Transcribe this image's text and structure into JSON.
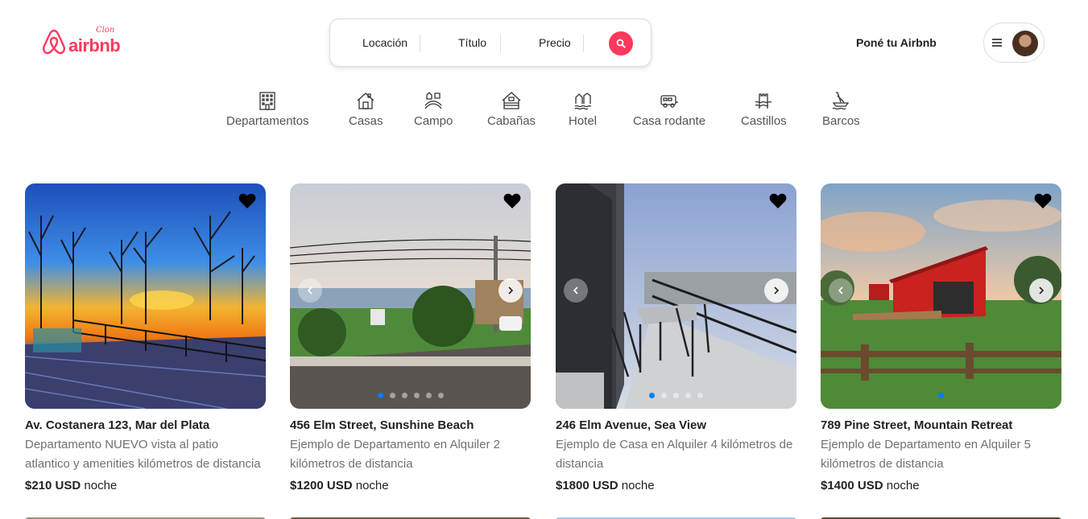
{
  "header": {
    "logo_text": "airbnb",
    "logo_badge": "Clon",
    "search": {
      "location": "Locación",
      "title": "Título",
      "price": "Precio"
    },
    "host_link": "Poné tu Airbnb"
  },
  "categories": [
    {
      "label": "Departamentos",
      "icon": "building-icon"
    },
    {
      "label": "Casas",
      "icon": "house-icon"
    },
    {
      "label": "Campo",
      "icon": "farm-icon"
    },
    {
      "label": "Cabañas",
      "icon": "cabin-icon"
    },
    {
      "label": "Hotel",
      "icon": "hotel-icon"
    },
    {
      "label": "Casa rodante",
      "icon": "camper-icon"
    },
    {
      "label": "Castillos",
      "icon": "castle-icon"
    },
    {
      "label": "Barcos",
      "icon": "boat-icon"
    }
  ],
  "listings": [
    {
      "title": "Av. Costanera 123, Mar del Plata",
      "description": "Departamento NUEVO vista al patio atlantico y amenities kilómetros de distancia",
      "price": "$210 USD",
      "price_unit": "noche"
    },
    {
      "title": "456 Elm Street, Sunshine Beach",
      "description": "Ejemplo de Departamento en Alquiler 2 kilómetros de distancia",
      "price": "$1200 USD",
      "price_unit": "noche"
    },
    {
      "title": "246 Elm Avenue, Sea View",
      "description": "Ejemplo de Casa en Alquiler 4 kilómetros de distancia",
      "price": "$1800 USD",
      "price_unit": "noche"
    },
    {
      "title": "789 Pine Street, Mountain Retreat",
      "description": "Ejemplo de Departamento en Alquiler 5 kilómetros de distancia",
      "price": "$1400 USD",
      "price_unit": "noche"
    }
  ],
  "colors": {
    "brand": "#ff385c",
    "active_dot": "#0a7cff"
  }
}
